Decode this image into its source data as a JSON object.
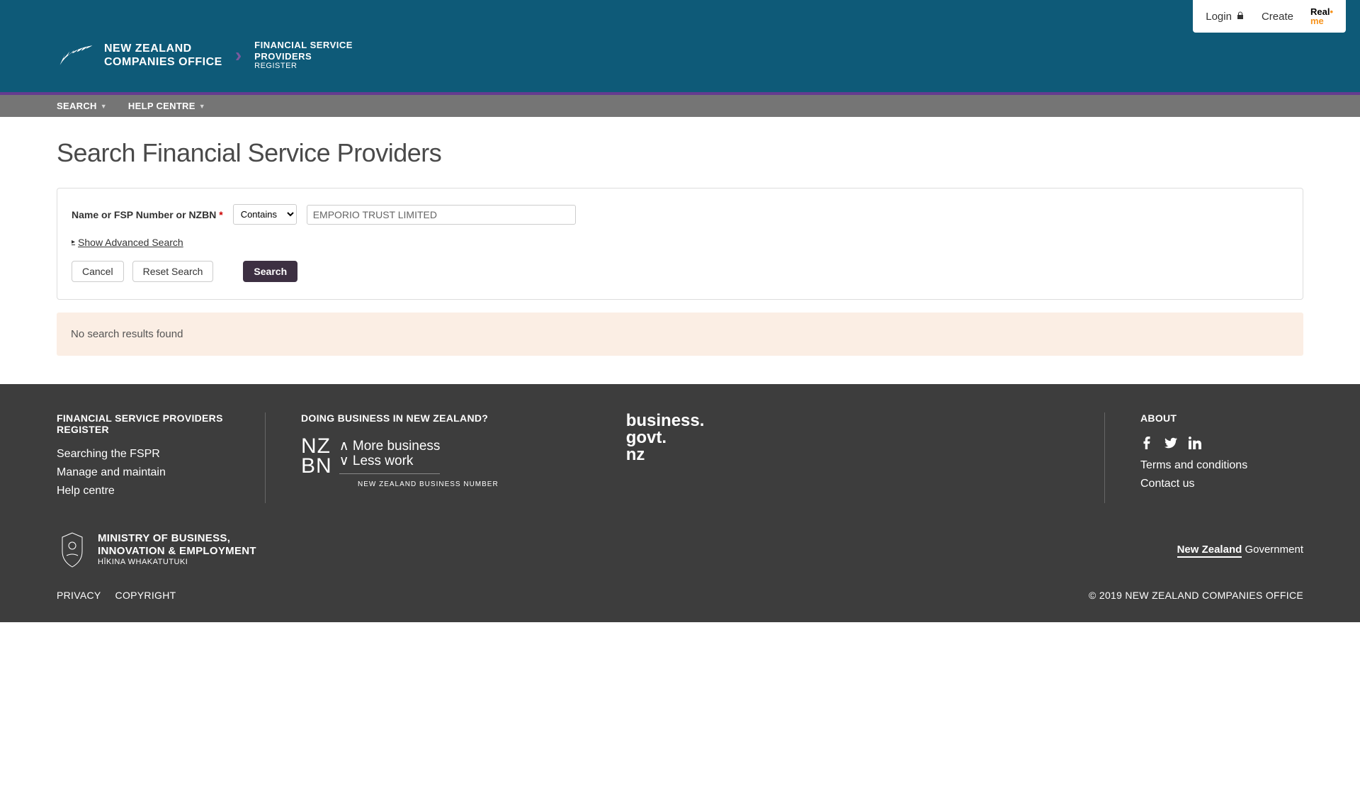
{
  "auth": {
    "login": "Login",
    "create": "Create"
  },
  "brand": {
    "line1": "NEW ZEALAND",
    "line2": "COMPANIES OFFICE",
    "fspr1": "FINANCIAL SERVICE",
    "fspr2": "PROVIDERS",
    "fspr3": "REGISTER"
  },
  "nav": {
    "search": "SEARCH",
    "help": "HELP CENTRE"
  },
  "page": {
    "title": "Search Financial Service Providers"
  },
  "search": {
    "label": "Name or FSP Number or NZBN",
    "asterisk": "*",
    "mode": "Contains",
    "value": "EMPORIO TRUST LIMITED",
    "advanced": "Show Advanced Search",
    "cancel": "Cancel",
    "reset": "Reset Search",
    "submit": "Search"
  },
  "results": {
    "none": "No search results found"
  },
  "footer": {
    "col1_heading": "FINANCIAL SERVICE PROVIDERS REGISTER",
    "link_search": "Searching the FSPR",
    "link_manage": "Manage and maintain",
    "link_help": "Help centre",
    "col2_heading": "DOING BUSINESS IN NEW ZEALAND?",
    "nzbn_tag1": "More business",
    "nzbn_tag2": "Less work",
    "nzbn_sub": "NEW ZEALAND BUSINESS NUMBER",
    "bgn1": "business.",
    "bgn2": "govt.",
    "bgn3": "nz",
    "col3_heading": "ABOUT",
    "link_terms": "Terms and conditions",
    "link_contact": "Contact us",
    "mbie1": "MINISTRY OF BUSINESS,",
    "mbie2": "INNOVATION & EMPLOYMENT",
    "mbie3": "HĪKINA WHAKATUTUKI",
    "nzgovt_bold": "New Zealand",
    "nzgovt_rest": " Government",
    "privacy": "PRIVACY",
    "copyright_link": "COPYRIGHT",
    "copyright": "© 2019 NEW ZEALAND COMPANIES OFFICE"
  }
}
